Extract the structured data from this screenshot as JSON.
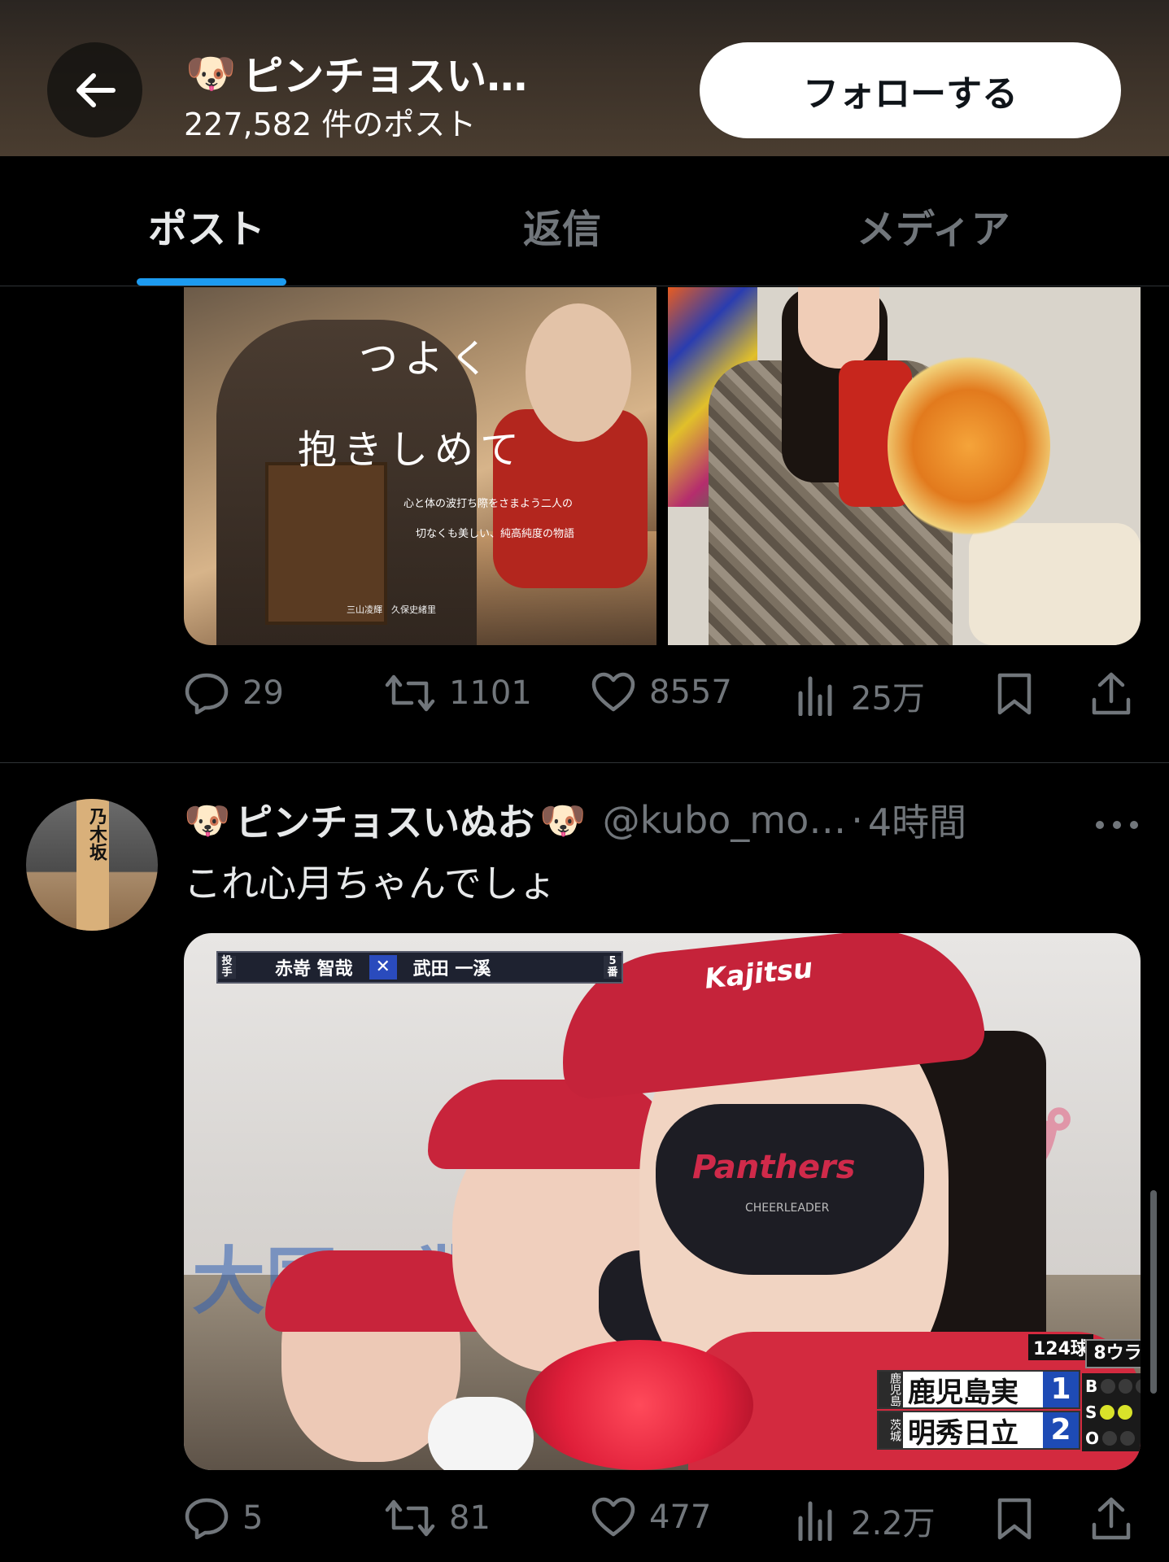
{
  "header": {
    "back_icon": "arrow-left-icon",
    "title_emoji": "🐶",
    "title": "ピンチョスい…",
    "post_count": "227,582 件のポスト",
    "follow_label": "フォローする"
  },
  "tabs": [
    {
      "label": "ポスト",
      "active": true
    },
    {
      "label": "返信",
      "active": false
    },
    {
      "label": "メディア",
      "active": false
    }
  ],
  "post1": {
    "poster_title_1": "つよく",
    "poster_title_2": "抱きしめて",
    "poster_line_1": "心と体の波打ち際をさまよう二人の",
    "poster_line_2": "切なくも美しい、純高純度の物語",
    "poster_credits": "三山凌輝　久保史緒里",
    "actions": {
      "replies": "29",
      "reposts": "1101",
      "likes": "8557",
      "views": "25万"
    }
  },
  "post2": {
    "avatar_sign": "乃木坂",
    "name_emoji": "🐶",
    "name": "ピンチョスいぬお",
    "handle": "@kubo_mo…",
    "dot": "·",
    "time": "4時間",
    "more_icon": "more-horizontal-icon",
    "text": "これ心月ちゃんでしょ",
    "media": {
      "tv_pitcher_label": "投手",
      "tv_player_1": "赤嵜 智哉",
      "tv_vs": "✕",
      "tv_player_2": "武田 一溪",
      "tv_order": "5番",
      "visor_text": "Kajitsu",
      "mask_text": "Panthers",
      "mask_sub": "CHEERLEADER",
      "banner_text": "大同工業",
      "banner_kana": "プ",
      "scoreboard": {
        "pitch_count": "124球",
        "inning": "8ウラ",
        "team1_pref": "鹿児島",
        "team1": "鹿児島実",
        "team1_runs": "1",
        "team2_pref": "茨城",
        "team2": "明秀日立",
        "team2_runs": "2",
        "b_label": "B",
        "s_label": "S",
        "o_label": "O",
        "balls": 0,
        "strikes": 2,
        "outs": 0
      }
    },
    "actions": {
      "replies": "5",
      "reposts": "81",
      "likes": "477",
      "views": "2.2万"
    }
  },
  "colors": {
    "accent": "#1d9bf0",
    "text": "#e7e9ea",
    "muted": "#71767b",
    "background": "#000000"
  }
}
